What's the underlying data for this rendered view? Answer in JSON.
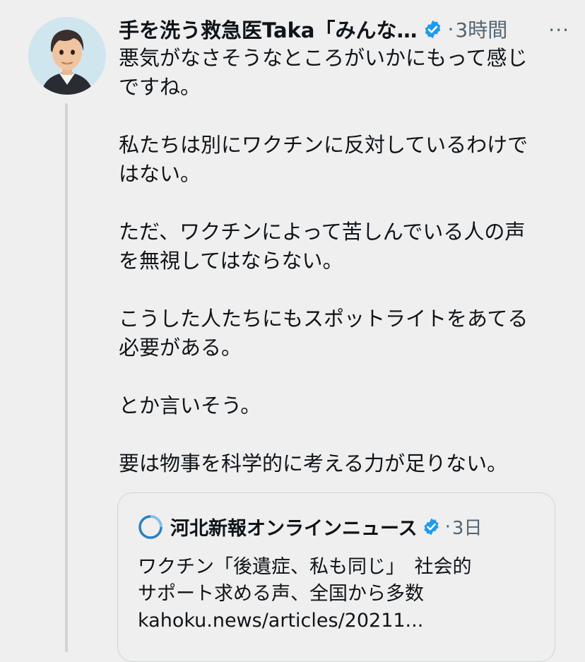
{
  "tweet": {
    "author_name": "手を洗う救急医Taka「みんな…",
    "timestamp": "3時間",
    "separator": "·",
    "more_label": "···",
    "avatar_icon": "avatar-illustration",
    "verified_icon": "verified-badge-icon",
    "body": "悪気がなさそうなところがいかにもって感じ\nですね。\n\n私たちは別にワクチンに反対しているわけで\nはない。\n\nただ、ワクチンによって苦しんでいる人の声\nを無視してはならない。\n\nこうした人たちにもスポットライトをあてる\n必要がある。\n\nとか言いそう。\n\n要は物事を科学的に考える力が足りない。"
  },
  "quote": {
    "author_name": "河北新報オンラインニュース",
    "timestamp": "3日",
    "separator": "·",
    "logo_icon": "kahoku-logo-icon",
    "body": "ワクチン「後遺症、私も同じ」　社会的\nサポート求める声、全国から多数\nkahoku.news/articles/20211..."
  },
  "colors": {
    "background": "#efefef",
    "text": "#0f1419",
    "muted": "#536471",
    "verified": "#1d9bf0",
    "thread_line": "#cfd3d7"
  }
}
